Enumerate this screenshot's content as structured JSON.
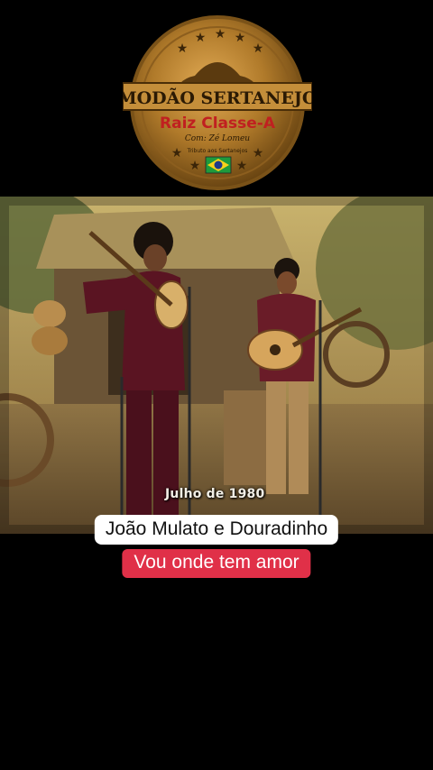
{
  "logo": {
    "line1": "MODÃO SERTANEJO",
    "line2": "Raiz Classe-A",
    "line3": "Com: Zé Lomeu",
    "line4": "Tributo aos Sertanejos",
    "flag": "brazil-flag"
  },
  "video": {
    "date_caption": "Julho de 1980"
  },
  "overlay": {
    "title": "João Mulato e Douradinho",
    "subtitle": "Vou onde tem amor"
  },
  "colors": {
    "background": "#000000",
    "title_bg": "#ffffff",
    "subtitle_bg": "#e03048",
    "logo_gold": "#b07a2a"
  }
}
